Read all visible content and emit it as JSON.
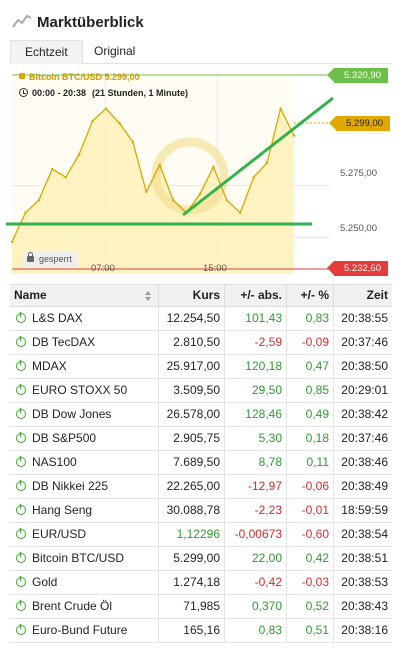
{
  "header": {
    "title": "Marktüberblick",
    "icon": "trend-line-icon"
  },
  "tabs": [
    {
      "label": "Echtzeit",
      "active": true
    },
    {
      "label": "Original",
      "active": false
    }
  ],
  "chart": {
    "legend": "Bitcoin BTC/USD  5.299,00",
    "range": "00:00 - 20:38",
    "range_detail": "(21 Stunden, 1 Minute)",
    "high_label": "5.320,90",
    "current_label": "5.299,00",
    "low_label": "5.232,60",
    "y_ticks": [
      "5.275,00",
      "5.250,00"
    ],
    "x_ticks": [
      "07:00",
      "15:00"
    ],
    "badge": "gesperrt",
    "colors": {
      "line": "#d8a600",
      "area": "#fff1b8",
      "high": "#6cc04a",
      "low": "#e43b3b",
      "trend": "#2fb34a"
    }
  },
  "chart_data": {
    "type": "area",
    "x": [
      "00:00",
      "01:00",
      "02:00",
      "03:00",
      "04:00",
      "05:00",
      "06:00",
      "07:00",
      "08:00",
      "09:00",
      "10:00",
      "11:00",
      "12:00",
      "13:00",
      "14:00",
      "15:00",
      "16:00",
      "17:00",
      "18:00",
      "19:00",
      "20:00",
      "20:38"
    ],
    "series": [
      {
        "name": "Bitcoin BTC/USD",
        "values": [
          5248,
          5262,
          5268,
          5283,
          5279,
          5290,
          5306,
          5312,
          5305,
          5296,
          5272,
          5285,
          5268,
          5262,
          5271,
          5284,
          5268,
          5262,
          5279,
          5286,
          5312,
          5299
        ]
      }
    ],
    "ylim": [
      5232.6,
      5320.9
    ],
    "high": 5320.9,
    "low": 5232.6,
    "current": 5299.0
  },
  "table": {
    "headers": {
      "name": "Name",
      "kurs": "Kurs",
      "abs": "+/- abs.",
      "pct": "+/- %",
      "zeit": "Zeit"
    },
    "rows": [
      {
        "name": "L&S DAX",
        "kurs": "12.254,50",
        "abs": "101,43",
        "pct": "0,83",
        "zeit": "20:38:55",
        "dir": "pos"
      },
      {
        "name": "DB TecDAX",
        "kurs": "2.810,50",
        "abs": "-2,59",
        "pct": "-0,09",
        "zeit": "20:37:46",
        "dir": "neg"
      },
      {
        "name": "MDAX",
        "kurs": "25.917,00",
        "abs": "120,18",
        "pct": "0,47",
        "zeit": "20:38:50",
        "dir": "pos"
      },
      {
        "name": "EURO STOXX 50",
        "kurs": "3.509,50",
        "abs": "29,50",
        "pct": "0,85",
        "zeit": "20:29:01",
        "dir": "pos"
      },
      {
        "name": "DB Dow Jones",
        "kurs": "26.578,00",
        "abs": "128,46",
        "pct": "0,49",
        "zeit": "20:38:42",
        "dir": "pos"
      },
      {
        "name": "DB S&P500",
        "kurs": "2.905,75",
        "abs": "5,30",
        "pct": "0,18",
        "zeit": "20:37:46",
        "dir": "pos"
      },
      {
        "name": "NAS100",
        "kurs": "7.689,50",
        "abs": "8,78",
        "pct": "0,11",
        "zeit": "20:38:46",
        "dir": "pos"
      },
      {
        "name": "DB Nikkei 225",
        "kurs": "22.265,00",
        "abs": "-12,97",
        "pct": "-0,06",
        "zeit": "20:38:49",
        "dir": "neg"
      },
      {
        "name": "Hang Seng",
        "kurs": "30.088,78",
        "abs": "-2,23",
        "pct": "-0,01",
        "zeit": "18:59:59",
        "dir": "neg"
      },
      {
        "name": "EUR/USD",
        "kurs": "1,12296",
        "abs": "-0,00673",
        "pct": "-0,60",
        "zeit": "20:38:54",
        "dir": "neg",
        "kurs_dir": "pos"
      },
      {
        "name": "Bitcoin BTC/USD",
        "kurs": "5.299,00",
        "abs": "22,00",
        "pct": "0,42",
        "zeit": "20:38:51",
        "dir": "pos"
      },
      {
        "name": "Gold",
        "kurs": "1.274,18",
        "abs": "-0,42",
        "pct": "-0,03",
        "zeit": "20:38:53",
        "dir": "neg"
      },
      {
        "name": "Brent Crude Öl",
        "kurs": "71,985",
        "abs": "0,370",
        "pct": "0,52",
        "zeit": "20:38:43",
        "dir": "pos"
      },
      {
        "name": "Euro-Bund Future",
        "kurs": "165,16",
        "abs": "0,83",
        "pct": "0,51",
        "zeit": "20:38:16",
        "dir": "pos"
      }
    ]
  }
}
